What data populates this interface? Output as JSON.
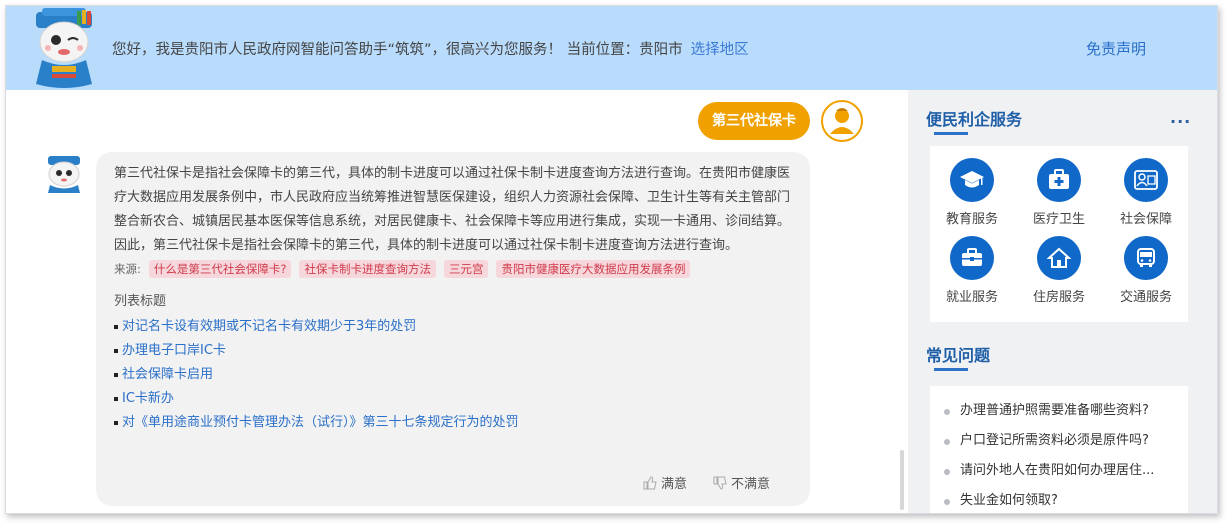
{
  "header": {
    "greeting": "您好，我是贵阳市人民政府网智能问答助手“筑筑”，很高兴为您服务！ 当前位置：贵阳市",
    "select_region": "选择地区",
    "disclaimer": "免责声明"
  },
  "chat": {
    "user_message": "第三代社保卡",
    "answer": "第三代社保卡是指社会保障卡的第三代，具体的制卡进度可以通过社保卡制卡进度查询方法进行查询。在贵阳市健康医疗大数据应用发展条例中，市人民政府应当统筹推进智慧医保建设，组织人力资源社会保障、卫生计生等有关主管部门整合新农合、城镇居民基本医保等信息系统，对居民健康卡、社会保障卡等应用进行集成，实现一卡通用、诊间结算。因此，第三代社保卡是指社会保障卡的第三代，具体的制卡进度可以通过社保卡制卡进度查询方法进行查询。",
    "source_label": "来源:",
    "sources": [
      "什么是第三代社会保障卡?",
      "社保卡制卡进度查询方法",
      "三元宫",
      "贵阳市健康医疗大数据应用发展条例"
    ],
    "list_title": "列表标题",
    "list_items": [
      "对记名卡设有效期或不记名卡有效期少于3年的处罚",
      "办理电子口岸IC卡",
      "社会保障卡启用",
      "IC卡新办",
      "对《单用途商业预付卡管理办法（试行）》第三十七条规定行为的处罚"
    ],
    "satisfied": "满意",
    "unsatisfied": "不满意"
  },
  "side": {
    "services_title": "便民利企服务",
    "more": "···",
    "services": [
      {
        "label": "教育服务",
        "icon": "graduation-cap-icon"
      },
      {
        "label": "医疗卫生",
        "icon": "medical-kit-icon"
      },
      {
        "label": "社会保障",
        "icon": "insurance-card-icon"
      },
      {
        "label": "就业服务",
        "icon": "briefcase-icon"
      },
      {
        "label": "住房服务",
        "icon": "house-icon"
      },
      {
        "label": "交通服务",
        "icon": "bus-icon"
      }
    ],
    "faq_title": "常见问题",
    "faqs": [
      "办理普通护照需要准备哪些资料?",
      "户口登记所需资料必须是原件吗?",
      "请问外地人在贵阳如何办理居住...",
      "失业金如何领取?"
    ],
    "accent": "#1068c8"
  }
}
